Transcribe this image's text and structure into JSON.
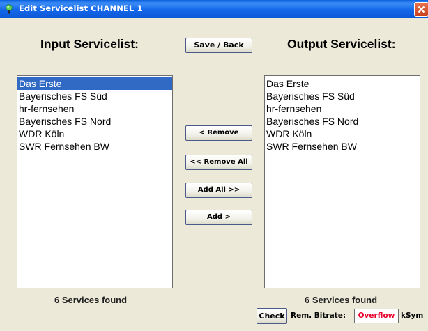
{
  "window": {
    "title": "Edit Servicelist CHANNEL 1"
  },
  "input": {
    "heading": "Input Servicelist:",
    "items": [
      "Das Erste",
      "Bayerisches FS Süd",
      "hr-fernsehen",
      "Bayerisches FS Nord",
      "WDR Köln",
      "SWR Fernsehen BW"
    ],
    "selected_index": 0,
    "count_label": "6 Services found"
  },
  "output": {
    "heading": "Output Servicelist:",
    "items": [
      "Das Erste",
      "Bayerisches FS Süd",
      "hr-fernsehen",
      "Bayerisches FS Nord",
      "WDR Köln",
      "SWR Fernsehen BW"
    ],
    "count_label": "6 Services found"
  },
  "buttons": {
    "save_back": "Save / Back",
    "remove": "< Remove",
    "remove_all": "<< Remove All",
    "add_all": "Add All >>",
    "add": "Add >",
    "check": "Check"
  },
  "bitrate": {
    "label": "Rem. Bitrate:",
    "value": "Overflow",
    "value_color": "#e8002a",
    "unit": "kSym"
  },
  "colors": {
    "titlebar": "#0c58d6",
    "selection": "#316ac5",
    "background": "#ece9d8"
  },
  "icons": {
    "app": "app-icon",
    "close": "close-icon"
  }
}
